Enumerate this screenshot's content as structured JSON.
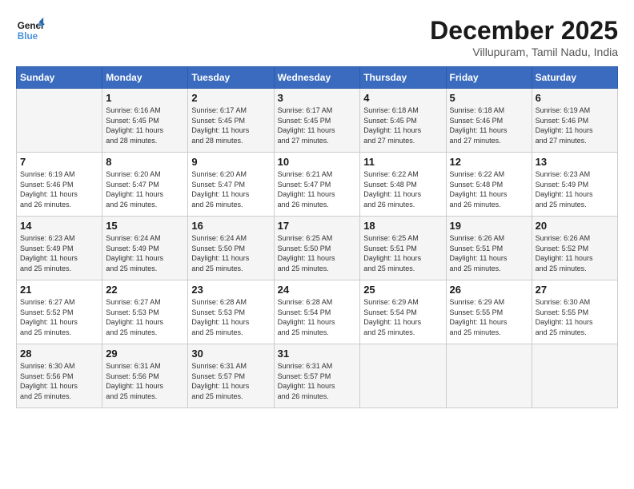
{
  "header": {
    "logo_line1": "General",
    "logo_line2": "Blue",
    "month_title": "December 2025",
    "subtitle": "Villupuram, Tamil Nadu, India"
  },
  "days_of_week": [
    "Sunday",
    "Monday",
    "Tuesday",
    "Wednesday",
    "Thursday",
    "Friday",
    "Saturday"
  ],
  "weeks": [
    [
      {
        "day": "",
        "info": ""
      },
      {
        "day": "1",
        "info": "Sunrise: 6:16 AM\nSunset: 5:45 PM\nDaylight: 11 hours\nand 28 minutes."
      },
      {
        "day": "2",
        "info": "Sunrise: 6:17 AM\nSunset: 5:45 PM\nDaylight: 11 hours\nand 28 minutes."
      },
      {
        "day": "3",
        "info": "Sunrise: 6:17 AM\nSunset: 5:45 PM\nDaylight: 11 hours\nand 27 minutes."
      },
      {
        "day": "4",
        "info": "Sunrise: 6:18 AM\nSunset: 5:45 PM\nDaylight: 11 hours\nand 27 minutes."
      },
      {
        "day": "5",
        "info": "Sunrise: 6:18 AM\nSunset: 5:46 PM\nDaylight: 11 hours\nand 27 minutes."
      },
      {
        "day": "6",
        "info": "Sunrise: 6:19 AM\nSunset: 5:46 PM\nDaylight: 11 hours\nand 27 minutes."
      }
    ],
    [
      {
        "day": "7",
        "info": "Sunrise: 6:19 AM\nSunset: 5:46 PM\nDaylight: 11 hours\nand 26 minutes."
      },
      {
        "day": "8",
        "info": "Sunrise: 6:20 AM\nSunset: 5:47 PM\nDaylight: 11 hours\nand 26 minutes."
      },
      {
        "day": "9",
        "info": "Sunrise: 6:20 AM\nSunset: 5:47 PM\nDaylight: 11 hours\nand 26 minutes."
      },
      {
        "day": "10",
        "info": "Sunrise: 6:21 AM\nSunset: 5:47 PM\nDaylight: 11 hours\nand 26 minutes."
      },
      {
        "day": "11",
        "info": "Sunrise: 6:22 AM\nSunset: 5:48 PM\nDaylight: 11 hours\nand 26 minutes."
      },
      {
        "day": "12",
        "info": "Sunrise: 6:22 AM\nSunset: 5:48 PM\nDaylight: 11 hours\nand 26 minutes."
      },
      {
        "day": "13",
        "info": "Sunrise: 6:23 AM\nSunset: 5:49 PM\nDaylight: 11 hours\nand 25 minutes."
      }
    ],
    [
      {
        "day": "14",
        "info": "Sunrise: 6:23 AM\nSunset: 5:49 PM\nDaylight: 11 hours\nand 25 minutes."
      },
      {
        "day": "15",
        "info": "Sunrise: 6:24 AM\nSunset: 5:49 PM\nDaylight: 11 hours\nand 25 minutes."
      },
      {
        "day": "16",
        "info": "Sunrise: 6:24 AM\nSunset: 5:50 PM\nDaylight: 11 hours\nand 25 minutes."
      },
      {
        "day": "17",
        "info": "Sunrise: 6:25 AM\nSunset: 5:50 PM\nDaylight: 11 hours\nand 25 minutes."
      },
      {
        "day": "18",
        "info": "Sunrise: 6:25 AM\nSunset: 5:51 PM\nDaylight: 11 hours\nand 25 minutes."
      },
      {
        "day": "19",
        "info": "Sunrise: 6:26 AM\nSunset: 5:51 PM\nDaylight: 11 hours\nand 25 minutes."
      },
      {
        "day": "20",
        "info": "Sunrise: 6:26 AM\nSunset: 5:52 PM\nDaylight: 11 hours\nand 25 minutes."
      }
    ],
    [
      {
        "day": "21",
        "info": "Sunrise: 6:27 AM\nSunset: 5:52 PM\nDaylight: 11 hours\nand 25 minutes."
      },
      {
        "day": "22",
        "info": "Sunrise: 6:27 AM\nSunset: 5:53 PM\nDaylight: 11 hours\nand 25 minutes."
      },
      {
        "day": "23",
        "info": "Sunrise: 6:28 AM\nSunset: 5:53 PM\nDaylight: 11 hours\nand 25 minutes."
      },
      {
        "day": "24",
        "info": "Sunrise: 6:28 AM\nSunset: 5:54 PM\nDaylight: 11 hours\nand 25 minutes."
      },
      {
        "day": "25",
        "info": "Sunrise: 6:29 AM\nSunset: 5:54 PM\nDaylight: 11 hours\nand 25 minutes."
      },
      {
        "day": "26",
        "info": "Sunrise: 6:29 AM\nSunset: 5:55 PM\nDaylight: 11 hours\nand 25 minutes."
      },
      {
        "day": "27",
        "info": "Sunrise: 6:30 AM\nSunset: 5:55 PM\nDaylight: 11 hours\nand 25 minutes."
      }
    ],
    [
      {
        "day": "28",
        "info": "Sunrise: 6:30 AM\nSunset: 5:56 PM\nDaylight: 11 hours\nand 25 minutes."
      },
      {
        "day": "29",
        "info": "Sunrise: 6:31 AM\nSunset: 5:56 PM\nDaylight: 11 hours\nand 25 minutes."
      },
      {
        "day": "30",
        "info": "Sunrise: 6:31 AM\nSunset: 5:57 PM\nDaylight: 11 hours\nand 25 minutes."
      },
      {
        "day": "31",
        "info": "Sunrise: 6:31 AM\nSunset: 5:57 PM\nDaylight: 11 hours\nand 26 minutes."
      },
      {
        "day": "",
        "info": ""
      },
      {
        "day": "",
        "info": ""
      },
      {
        "day": "",
        "info": ""
      }
    ]
  ]
}
